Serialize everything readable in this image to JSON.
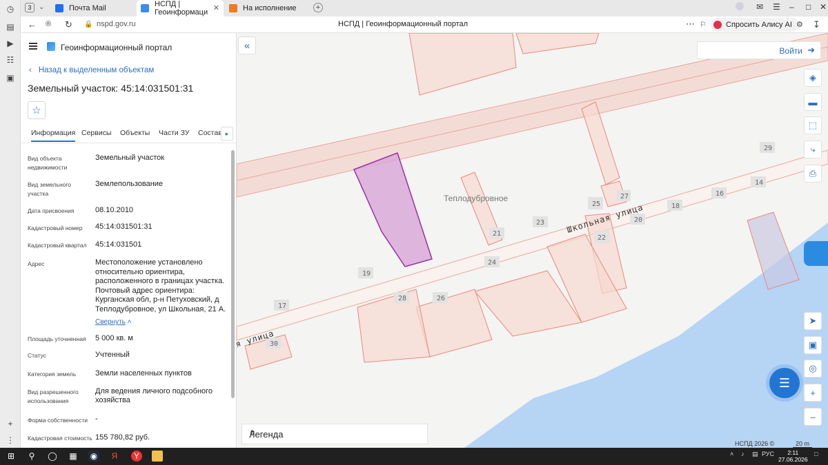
{
  "browser": {
    "tab_counter": "3",
    "tabs": [
      {
        "label": "Почта Mail"
      },
      {
        "label": "НСПД | Геоинформаци"
      },
      {
        "label": "На исполнение"
      }
    ],
    "url": "nspd.gov.ru",
    "page_title": "НСПД | Геоинформационный портал",
    "alice_label": "Спросить Алису AI"
  },
  "panel": {
    "portal_name": "Геоинформационный портал",
    "back_label": "Назад к выделенным объектам",
    "heading": "Земельный участок: 45:14:031501:31",
    "tabs": [
      "Информация",
      "Сервисы",
      "Объекты",
      "Части ЗУ",
      "Состав"
    ],
    "fields": [
      {
        "label": "Вид объекта недвижимости",
        "value": "Земельный участок"
      },
      {
        "label": "Вид земельного участка",
        "value": "Землепользование"
      },
      {
        "label": "Дата присвоения",
        "value": "08.10.2010"
      },
      {
        "label": "Кадастровый номер",
        "value": "45:14:031501:31"
      },
      {
        "label": "Кадастровый квартал",
        "value": "45:14:031501"
      },
      {
        "label": "Адрес",
        "value": "Местоположение установлено относительно ориентира, расположенного в границах участка. Почтовый адрес ориентира: Курганская обл, р-н Петуховский, д Теплодубровное, ул Школьная, 21 А."
      },
      {
        "label": "Площадь уточненная",
        "value": "5 000 кв. м"
      },
      {
        "label": "Статус",
        "value": "Учтенный"
      },
      {
        "label": "Категория земель",
        "value": "Земли населенных пунктов"
      },
      {
        "label": "Вид разрешенного использования",
        "value": "Для ведения личного подсобного хозяйства"
      },
      {
        "label": "Форма собственности",
        "value": "-"
      },
      {
        "label": "Кадастровая стоимость",
        "value": "155 780,82 руб."
      }
    ],
    "collapse_label": "Свернуть"
  },
  "map": {
    "login_label": "Войти",
    "village_label": "Теплодубровное",
    "street_label_1": "Школьная улица",
    "street_label_2": "я улица",
    "house_numbers": [
      "29",
      "14",
      "16",
      "18",
      "20",
      "27",
      "25",
      "23",
      "21",
      "22",
      "24",
      "19",
      "28",
      "26",
      "17",
      "30"
    ],
    "legend_label": "Легенда",
    "copyright": "НСПД 2026 ©",
    "scale": "20 m",
    "colors": {
      "selected_parcel": "#9c2fa3",
      "parcel_outline": "#e8897a",
      "water": "#b6d4f4",
      "accent": "#2d6fbe"
    }
  },
  "taskbar": {
    "tray_lang": "РУС",
    "time": "2:11",
    "date": "27.06.2026"
  }
}
